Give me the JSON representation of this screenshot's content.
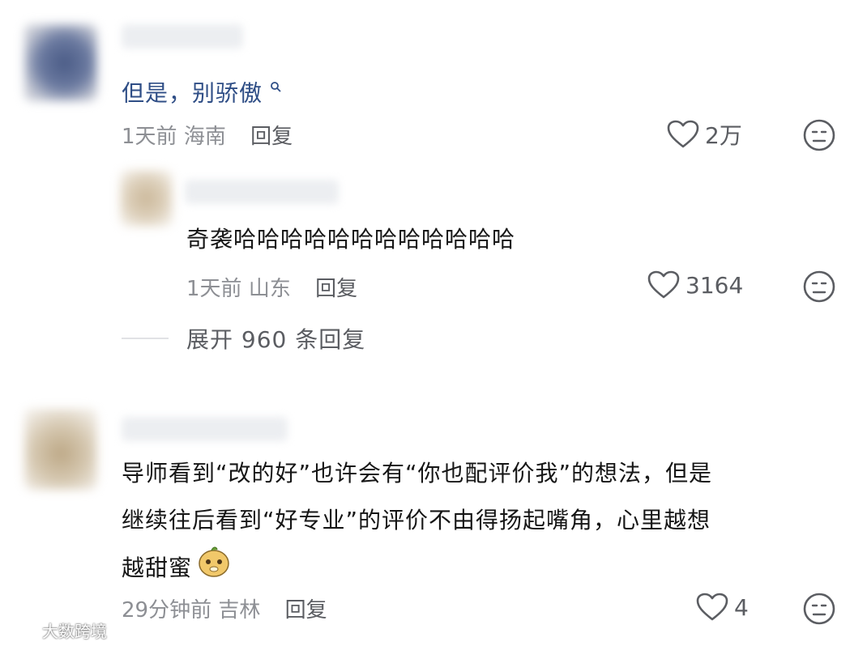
{
  "comments": [
    {
      "text": "但是，别骄傲",
      "time": "1天前",
      "location": "海南",
      "reply_label": "回复",
      "likes": "2万"
    },
    {
      "text": "奇袭哈哈哈哈哈哈哈哈哈哈哈哈",
      "time": "1天前",
      "location": "山东",
      "reply_label": "回复",
      "likes": "3164"
    },
    {
      "text_line1": "导师看到“改的好”也许会有“你也配评价我”的想法，但是",
      "text_line2": "继续往后看到“好专业”的评价不由得扬起嘴角，心里越想",
      "text_line3": "越甜蜜",
      "time": "29分钟前",
      "location": "吉林",
      "reply_label": "回复",
      "likes": "4"
    }
  ],
  "expand_replies": "展开 960 条回复",
  "watermark": "大数跨境",
  "colors": {
    "link_blue": "#2f4e86",
    "meta_gray": "#8d8f94",
    "icon_gray": "#5b5d62"
  }
}
